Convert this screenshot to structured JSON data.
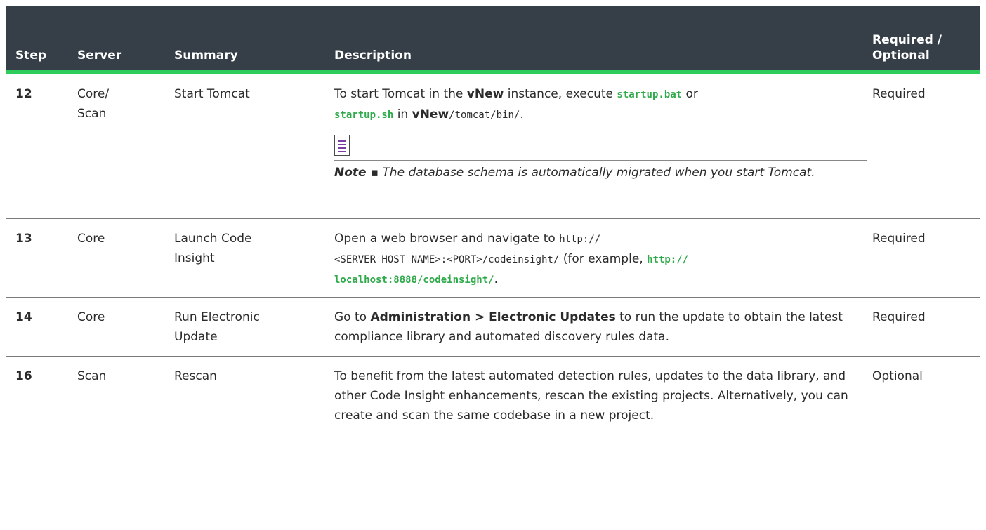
{
  "headers": {
    "step": "Step",
    "server": "Server",
    "summary": "Summary",
    "description": "Description",
    "required_line1": "Required /",
    "required_line2": "Optional"
  },
  "rows": [
    {
      "step": "12",
      "server_line1": "Core/",
      "server_line2": "Scan",
      "summary": "Start Tomcat",
      "desc": {
        "t1": "To start Tomcat in the ",
        "b1": "vNew",
        "t2": " instance, execute ",
        "code1": "startup.bat",
        "t3": " or",
        "code2": "startup.sh",
        "t4": " in ",
        "b2": "vNew",
        "mono1": "/tomcat/bin/",
        "t5": "."
      },
      "note_label": "Note ▪",
      "note_text": " The database schema is automatically migrated when you start Tomcat.",
      "required": "Required"
    },
    {
      "step": "13",
      "server": "Core",
      "summary_line1": "Launch Code",
      "summary_line2": "Insight",
      "desc": {
        "t1": "Open a web browser and navigate to ",
        "mono1": "http://",
        "mono2": "<SERVER_HOST_NAME>:<PORT>/codeinsight/",
        "t2": " (for example, ",
        "code1": "http://",
        "code2": "localhost:8888/codeinsight/",
        "t3": "."
      },
      "required": "Required"
    },
    {
      "step": "14",
      "server": "Core",
      "summary_line1": "Run Electronic",
      "summary_line2": "Update",
      "desc": {
        "t1": "Go to ",
        "b1": "Administration > Electronic Updates",
        "t2": " to run the update to obtain the latest compliance library and automated discovery rules data."
      },
      "required": "Required"
    },
    {
      "step": "16",
      "server": "Scan",
      "summary": "Rescan",
      "desc": {
        "t1": "To benefit from the latest automated detection rules, updates to the data library, and other Code Insight enhancements, rescan the existing projects. Alternatively, you can create and scan the same codebase in a new project."
      },
      "required": "Optional"
    }
  ]
}
